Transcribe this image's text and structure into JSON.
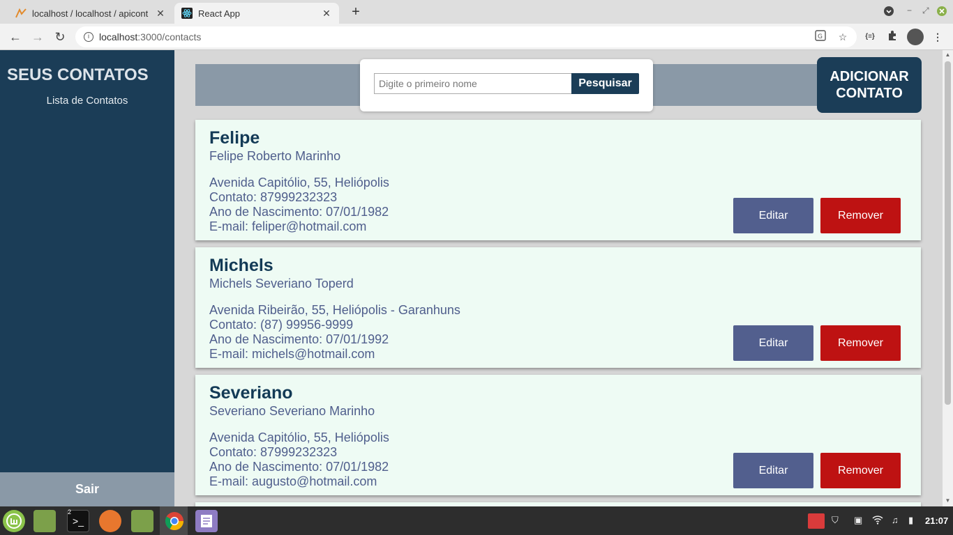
{
  "browser": {
    "tabs": [
      {
        "title": "localhost / localhost / apicont"
      },
      {
        "title": "React App"
      }
    ],
    "url_host": "localhost",
    "url_path": ":3000/contacts"
  },
  "sidebar": {
    "brand": "SEUS CONTATOS",
    "nav_item": "Lista de Contatos",
    "logout": "Sair"
  },
  "search": {
    "placeholder": "Digite o primeiro nome",
    "button": "Pesquisar"
  },
  "add_button": {
    "line1": "ADICIONAR",
    "line2": "CONTATO"
  },
  "contacts": [
    {
      "first_name": "Felipe",
      "full_name": "Felipe Roberto Marinho",
      "address": "Avenida Capitólio, 55, Heliópolis",
      "phone": "Contato: 87999232323",
      "birth": "Ano de Nascimento: 07/01/1982",
      "email": "E-mail: feliper@hotmail.com",
      "edit_label": "Editar",
      "remove_label": "Remover"
    },
    {
      "first_name": "Michels",
      "full_name": "Michels Severiano Toperd",
      "address": "Avenida Ribeirão, 55, Heliópolis - Garanhuns",
      "phone": "Contato: (87) 99956-9999",
      "birth": "Ano de Nascimento: 07/01/1992",
      "email": "E-mail: michels@hotmail.com",
      "edit_label": "Editar",
      "remove_label": "Remover"
    },
    {
      "first_name": "Severiano",
      "full_name": "Severiano Severiano Marinho",
      "address": "Avenida Capitólio, 55, Heliópolis",
      "phone": "Contato: 87999232323",
      "birth": "Ano de Nascimento: 07/01/1982",
      "email": "E-mail: augusto@hotmail.com",
      "edit_label": "Editar",
      "remove_label": "Remover"
    }
  ],
  "taskbar": {
    "terminal_badge": "2",
    "clock": "21:07"
  },
  "colors": {
    "sidebar": "#1b3d57",
    "card_bg": "#eefbf4",
    "edit": "#525f8e",
    "remove": "#be1212"
  }
}
